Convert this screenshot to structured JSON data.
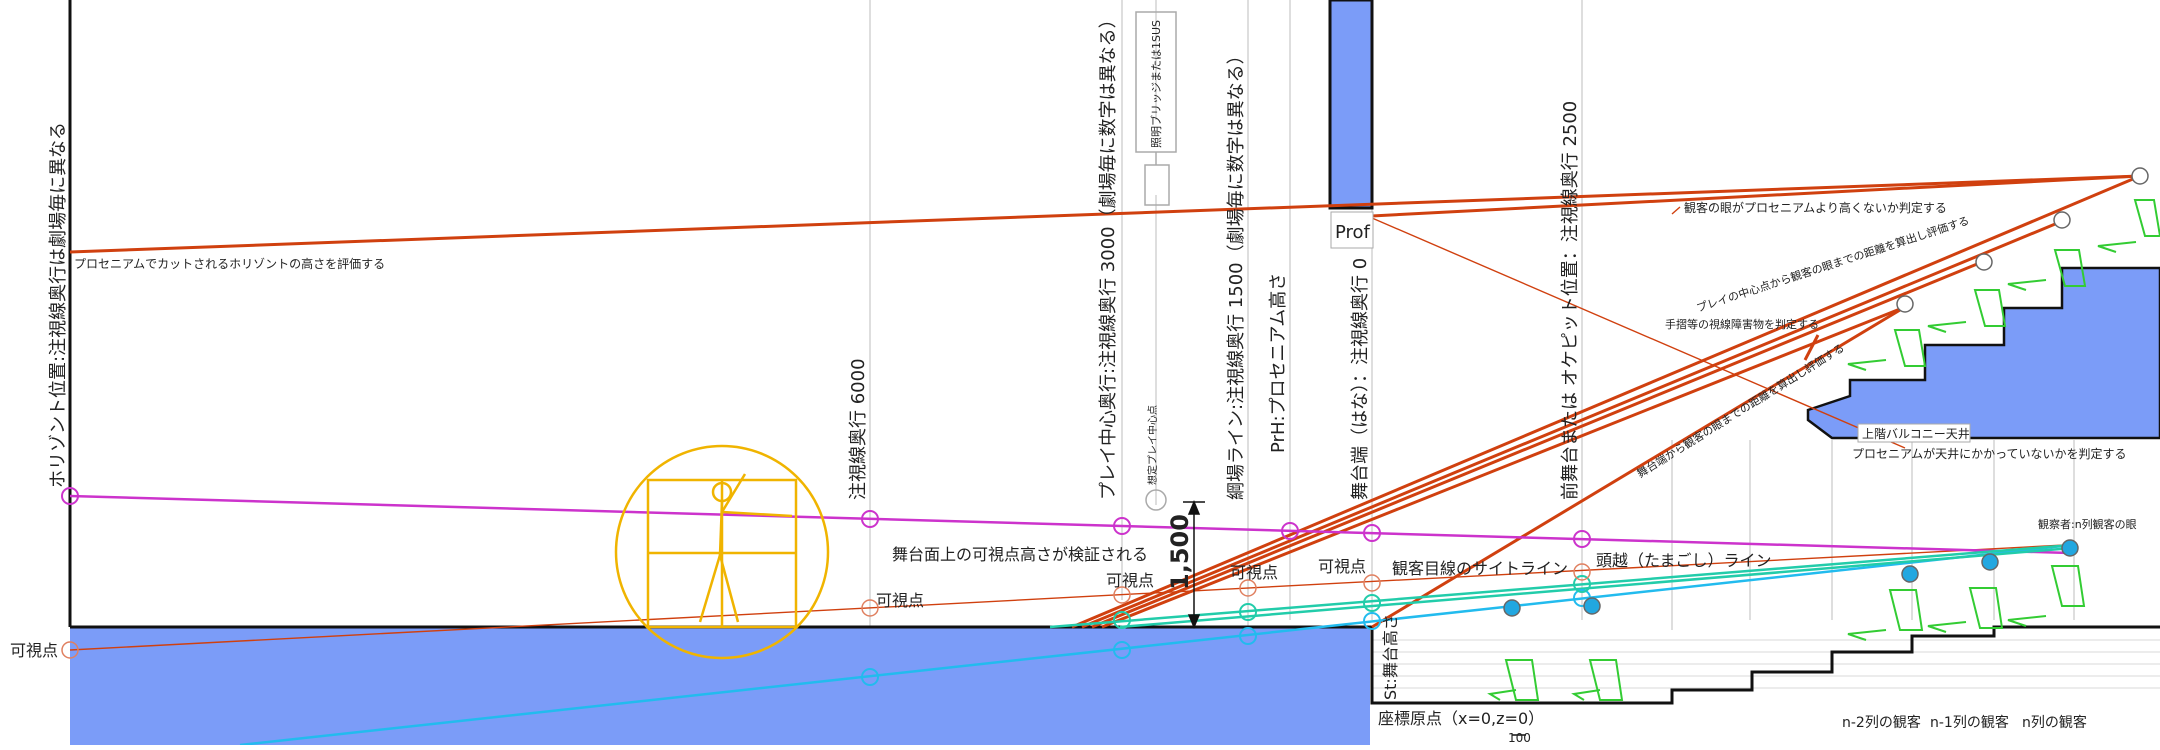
{
  "labels": {
    "horizon_vertical": "ホリゾント位置:注視線奥行は劇場毎に異なる",
    "horizon_note": "プロセニアムでカットされるホリゾントの高さを評価する",
    "gaze_6000": "注視線奥行 6000",
    "play_center": "プレイ中心奥行:注視線奥行 3000（劇場毎に数字は異なる）",
    "lighting_bridge": "照明ブリッジまたは1SUS",
    "assumed_play_center": "想定プレイ中心点",
    "tsuna_line": "綱場ライン:注視線奥行 1500（劇場毎に数字は異なる）",
    "prh": "PrH:プロセニアム高さ",
    "stage_edge": "舞台端（はな）：注視線奥行 0",
    "front_stage": "前舞台または オケピット位置：注視線奥行 2500",
    "prof": "Prof",
    "eye_vs_proscenium": "観客の眼がプロセニアムより高くないか判定する",
    "play_distance": "プレイの中心点から観客の眼までの距離を算出し評価する",
    "handrail": "手摺等の視線障害物を判定する",
    "stage_edge_distance": "舞台端から観客の眼までの距離を算出し評価する",
    "balcony_ceiling": "上階バルコニー天井",
    "proscenium_ceiling": "プロセニアムが天井にかかっていないかを判定する",
    "observer": "観察者:n列観客の眼",
    "visible_point": "可視点",
    "verify": "舞台面上の可視点高さが検証される",
    "dim_1500": "1,500",
    "sightline": "観客目線のサイトライン",
    "headline": "頭越（たまごし）ライン",
    "st_height": "St:舞台高さ",
    "origin": "座標原点（x=0,z=0）",
    "scale_100": "100",
    "row_n2": "n-2列の観客",
    "row_n1": "n-1列の観客",
    "row_n": "n列の観客"
  },
  "colors": {
    "stage_fill": "#7b9cf8",
    "sight_red": "#d0400f",
    "magenta": "#cc33cc",
    "cyan": "#22bbee",
    "teal": "#22ccaa",
    "orange": "#f0b400",
    "seat_green": "#33cc33",
    "head_cyan": "#22a7e0"
  }
}
